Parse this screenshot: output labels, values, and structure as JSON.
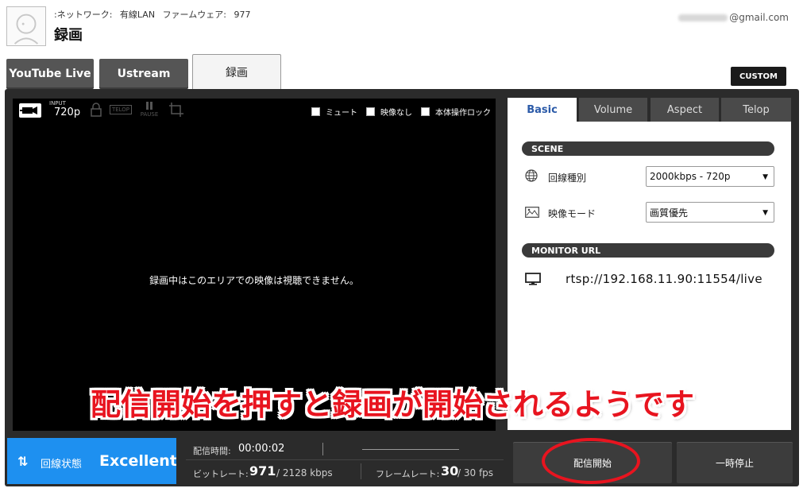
{
  "header": {
    "network_label": ":ネットワーク:",
    "network_value": "有線LAN",
    "firmware_label": "ファームウェア:",
    "firmware_value": "977",
    "title": "録画",
    "account_suffix": "@gmail.com"
  },
  "modes": {
    "youtube": "YouTube Live",
    "ustream": "Ustream",
    "record": "録画",
    "custom": "CUSTOM"
  },
  "video": {
    "input_label": "INPUT",
    "input_value": "720p",
    "telop_icon": "TELOP",
    "pause_icon": "PAUSE",
    "checks": {
      "mute": "ミュート",
      "no_video": "映像なし",
      "lock": "本体操作ロック"
    },
    "message": "録画中はこのエリアでの映像は視聴できません。"
  },
  "settings": {
    "tabs": [
      "Basic",
      "Volume",
      "Aspect",
      "Telop"
    ],
    "active_tab": "Basic",
    "scene_header": "SCENE",
    "line_type_label": "回線種別",
    "line_type_value": "2000kbps - 720p",
    "video_mode_label": "映像モード",
    "video_mode_value": "画質優先",
    "monitor_header": "MONITOR URL",
    "monitor_url": "rtsp://192.168.11.90:11554/live"
  },
  "status": {
    "conn_label": "回線状態",
    "conn_value": "Excellent",
    "time_label": "配信時間:",
    "time_value": "00:00:02",
    "bitrate_label": "ビットレート:",
    "bitrate_value": "971",
    "bitrate_total": "/ 2128 kbps",
    "framerate_label": "フレームレート:",
    "framerate_value": "30",
    "framerate_total": "/ 30 fps"
  },
  "actions": {
    "start": "配信開始",
    "pause": "一時停止"
  },
  "annotation": "配信開始を押すと録画が開始されるようです",
  "colors": {
    "accent_blue": "#1e90f0",
    "annotation_red": "#e8141f",
    "panel_dark": "#2b2b2b"
  }
}
